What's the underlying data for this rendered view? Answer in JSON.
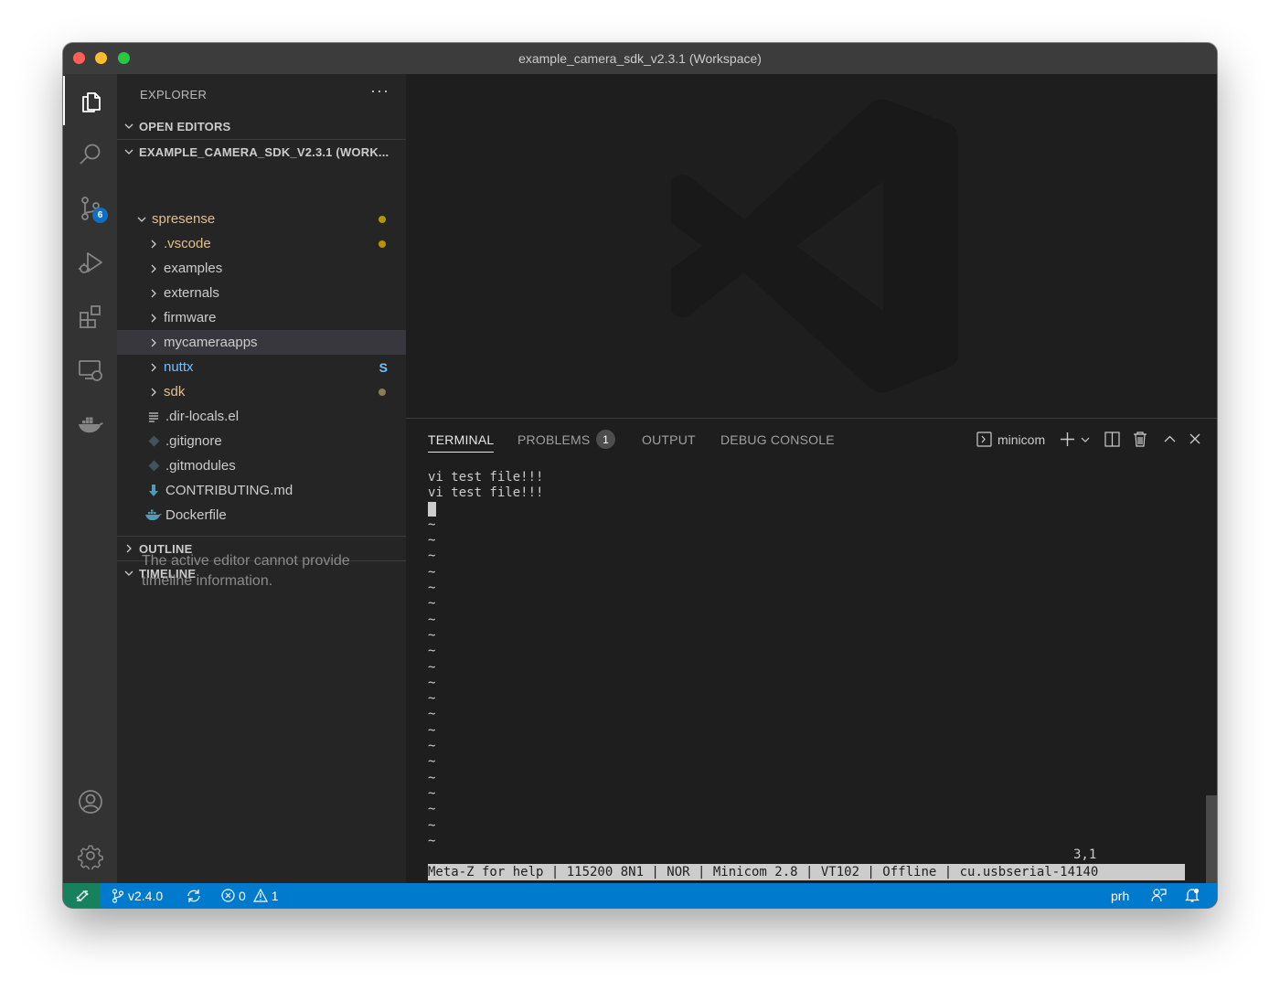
{
  "window": {
    "title": "example_camera_sdk_v2.3.1 (Workspace)"
  },
  "activity_bar": {
    "source_control_badge": "6",
    "items": [
      "files-icon",
      "search-icon",
      "source-control-icon",
      "run-debug-icon",
      "extensions-icon",
      "remote-explorer-icon",
      "docker-icon",
      "accounts-icon",
      "manage-gear-icon"
    ]
  },
  "explorer": {
    "title": "EXPLORER",
    "more_actions": "···",
    "open_editors": "OPEN EDITORS",
    "workspace": "EXAMPLE_CAMERA_SDK_V2.3.1 (WORK...",
    "root_folder": {
      "name": "spresense",
      "color": "#e2c08d",
      "dot_color": "#b89500"
    },
    "items": [
      {
        "name": ".vscode",
        "type": "folder",
        "color": "#e2c08d",
        "decoration": "dot",
        "deco_color": "#b89500"
      },
      {
        "name": "examples",
        "type": "folder",
        "color": "#cccccc"
      },
      {
        "name": "externals",
        "type": "folder",
        "color": "#cccccc"
      },
      {
        "name": "firmware",
        "type": "folder",
        "color": "#cccccc"
      },
      {
        "name": "mycameraapps",
        "type": "folder",
        "color": "#cccccc",
        "selected": true
      },
      {
        "name": "nuttx",
        "type": "folder",
        "color": "#73c0ff",
        "decoration": "S"
      },
      {
        "name": "sdk",
        "type": "folder",
        "color": "#e2c08d",
        "decoration": "dot",
        "deco_color": "#8d7b55"
      },
      {
        "name": ".dir-locals.el",
        "type": "file",
        "icon": "lines-icon",
        "color": "#cccccc"
      },
      {
        "name": ".gitignore",
        "type": "file",
        "icon": "git-icon",
        "color": "#cccccc"
      },
      {
        "name": ".gitmodules",
        "type": "file",
        "icon": "git-icon",
        "color": "#cccccc"
      },
      {
        "name": "CONTRIBUTING.md",
        "type": "file",
        "icon": "markdown-download-icon",
        "color": "#cccccc"
      },
      {
        "name": "Dockerfile",
        "type": "file",
        "icon": "docker-file-icon",
        "color": "#cccccc"
      }
    ],
    "outline": "OUTLINE",
    "timeline": "TIMELINE",
    "timeline_message": "The active editor cannot provide timeline information."
  },
  "panel": {
    "tabs": {
      "terminal": "TERMINAL",
      "problems": "PROBLEMS",
      "problems_count": "1",
      "output": "OUTPUT",
      "debug_console": "DEBUG CONSOLE"
    },
    "terminal_name": "minicom",
    "terminal": {
      "lines": [
        "vi test file!!!",
        "vi test file!!!"
      ],
      "tilde_count": 21,
      "position": "3,1",
      "status_line": "Meta-Z for help | 115200 8N1 | NOR | Minicom 2.8 | VT102 | Offline | cu.usbserial-14140"
    }
  },
  "status_bar": {
    "branch": "v2.4.0",
    "errors": "0",
    "warnings": "1",
    "user": "prh",
    "bg_color": "#007acc",
    "remote_color": "#16825d"
  }
}
